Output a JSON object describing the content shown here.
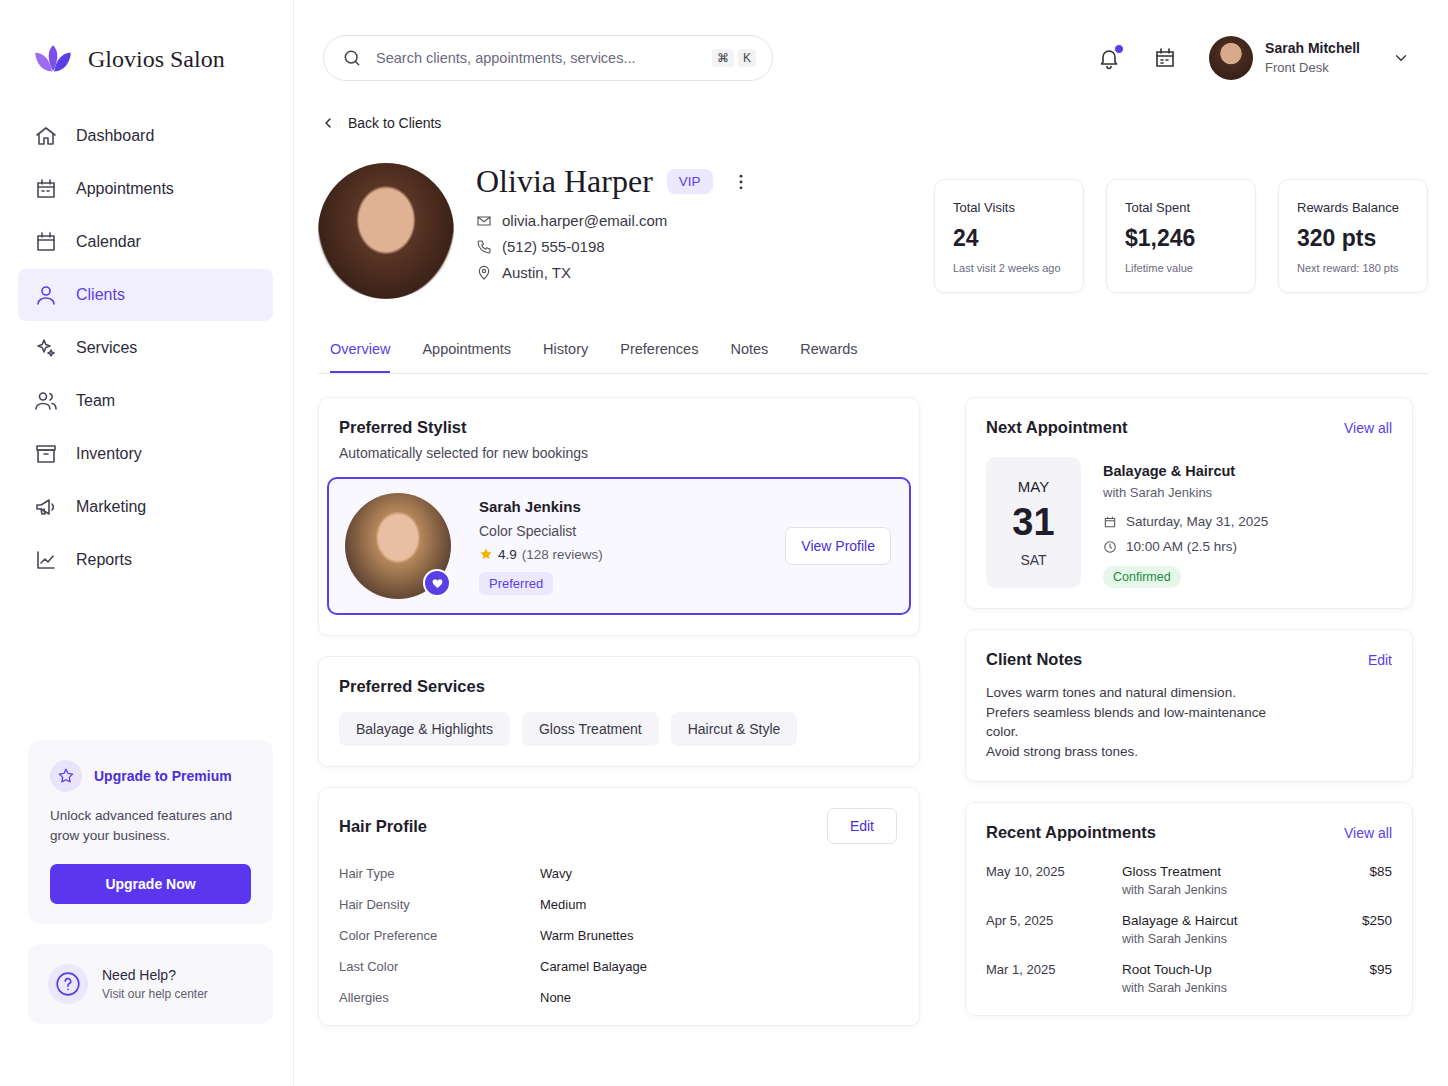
{
  "brand": {
    "name": "Glovios Salon"
  },
  "sidebar": {
    "items": [
      {
        "label": "Dashboard",
        "selected": false
      },
      {
        "label": "Appointments",
        "selected": false
      },
      {
        "label": "Calendar",
        "selected": false
      },
      {
        "label": "Clients",
        "selected": true
      },
      {
        "label": "Services",
        "selected": false
      },
      {
        "label": "Team",
        "selected": false
      },
      {
        "label": "Inventory",
        "selected": false
      },
      {
        "label": "Marketing",
        "selected": false
      },
      {
        "label": "Reports",
        "selected": false
      }
    ]
  },
  "upgrade": {
    "title": "Upgrade to Premium",
    "text": "Unlock advanced features and grow your business.",
    "button": "Upgrade Now"
  },
  "help": {
    "title": "Need Help?",
    "text": "Visit our help center"
  },
  "search": {
    "placeholder": "Search clients, appointments, services...",
    "keys": [
      "⌘",
      "K"
    ]
  },
  "notifications": {
    "unread": true
  },
  "user": {
    "name": "Sarah Mitchell",
    "role": "Front Desk"
  },
  "back": "Back to Clients",
  "client": {
    "name": "Olivia Harper",
    "badge": "VIP",
    "email": "olivia.harper@email.com",
    "phone": "(512) 555-0198",
    "location": "Austin, TX"
  },
  "stats": [
    {
      "label": "Total Visits",
      "value": "24",
      "sub": "Last visit 2 weeks ago"
    },
    {
      "label": "Total Spent",
      "value": "$1,246",
      "sub": "Lifetime value"
    },
    {
      "label": "Rewards Balance",
      "value": "320 pts",
      "sub": "Next reward: 180 pts"
    }
  ],
  "tabs": [
    {
      "label": "Overview",
      "selected": true
    },
    {
      "label": "Appointments",
      "selected": false
    },
    {
      "label": "History",
      "selected": false
    },
    {
      "label": "Preferences",
      "selected": false
    },
    {
      "label": "Notes",
      "selected": false
    },
    {
      "label": "Rewards",
      "selected": false
    }
  ],
  "preferred_stylist": {
    "title": "Preferred Stylist",
    "subtitle": "Automatically selected for new bookings",
    "name": "Sarah Jenkins",
    "role": "Color Specialist",
    "stars": 1,
    "rating": "4.9",
    "reviews": "(128 reviews)",
    "badge": "Preferred",
    "favorite": true,
    "selected": true,
    "button": "View Profile"
  },
  "preferred_services": {
    "title": "Preferred Services",
    "items": [
      "Balayage & Highlights",
      "Gloss Treatment",
      "Haircut & Style"
    ]
  },
  "hair_profile": {
    "title": "Hair Profile",
    "edit": "Edit",
    "rows": [
      {
        "label": "Hair Type",
        "value": "Wavy"
      },
      {
        "label": "Hair Density",
        "value": "Medium"
      },
      {
        "label": "Color Preference",
        "value": "Warm Brunettes"
      },
      {
        "label": "Last Color",
        "value": "Caramel Balayage"
      },
      {
        "label": "Allergies",
        "value": "None"
      }
    ]
  },
  "next_appointment": {
    "title": "Next Appointment",
    "link": "View all",
    "month": "MAY",
    "day": "31",
    "weekday": "SAT",
    "service": "Balayage & Haircut",
    "stylist": "with Sarah Jenkins",
    "date": "Saturday, May 31, 2025",
    "time": "10:00 AM (2.5 hrs)",
    "status": "Confirmed"
  },
  "client_notes": {
    "title": "Client Notes",
    "edit": "Edit",
    "lines": [
      "Loves warm tones and natural dimension.",
      "Prefers seamless blends and low-maintenance color.",
      "Avoid strong brass tones."
    ]
  },
  "recent_appointments": {
    "title": "Recent Appointments",
    "link": "View all",
    "rows": [
      {
        "date": "May 10, 2025",
        "service": "Gloss Treatment",
        "stylist": "with Sarah Jenkins",
        "price": "$85"
      },
      {
        "date": "Apr 5, 2025",
        "service": "Balayage & Haircut",
        "stylist": "with Sarah Jenkins",
        "price": "$250"
      },
      {
        "date": "Mar 1, 2025",
        "service": "Root Touch-Up",
        "stylist": "with Sarah Jenkins",
        "price": "$95"
      }
    ]
  }
}
